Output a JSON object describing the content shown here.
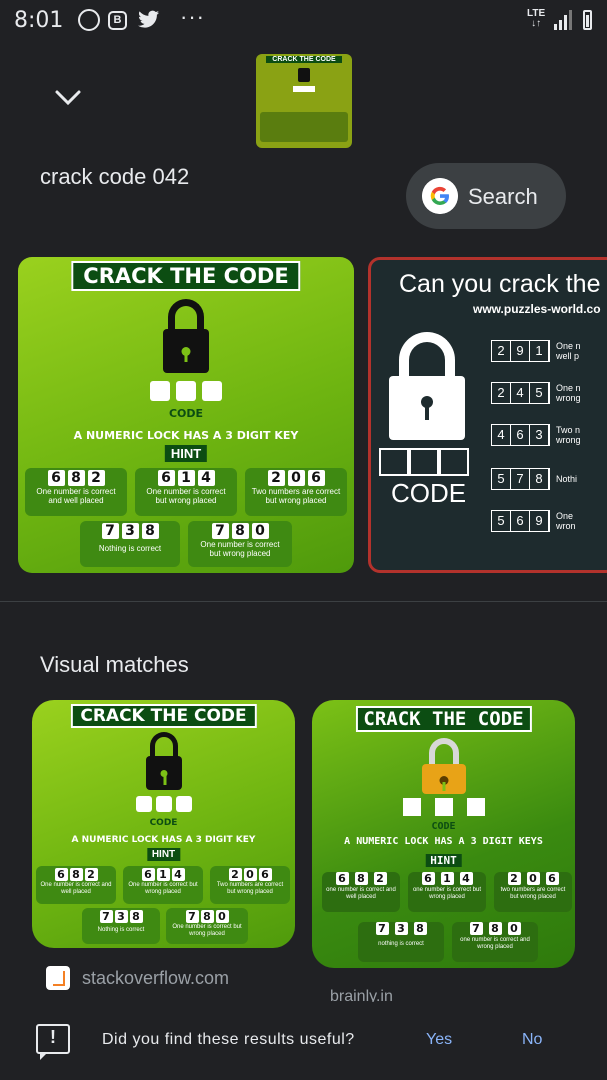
{
  "status_bar": {
    "time": "8:01",
    "network": "LTE",
    "overflow": "···",
    "app_badge": "B"
  },
  "header": {
    "query": "crack code 042",
    "search_label": "Search",
    "thumb_title": "CRACK THE CODE"
  },
  "puzzle": {
    "title": "CRACK THE CODE",
    "code_label": "CODE",
    "statement": "A NUMERIC LOCK HAS A 3 DIGIT KEY",
    "hint": "HINT",
    "clues": [
      {
        "digits": [
          "6",
          "8",
          "2"
        ],
        "text": "One number is correct and well placed"
      },
      {
        "digits": [
          "6",
          "1",
          "4"
        ],
        "text": "One number is correct but wrong placed"
      },
      {
        "digits": [
          "2",
          "0",
          "6"
        ],
        "text": "Two numbers are correct but wrong placed"
      },
      {
        "digits": [
          "7",
          "3",
          "8"
        ],
        "text": "Nothing is correct"
      },
      {
        "digits": [
          "7",
          "8",
          "0"
        ],
        "text": "One number is correct but wrong placed"
      }
    ]
  },
  "card2": {
    "title": "Can you crack the",
    "url": "www.puzzles-world.co",
    "code_label": "CODE",
    "rows": [
      {
        "digits": [
          "2",
          "9",
          "1"
        ],
        "text": [
          "One n",
          "well p"
        ]
      },
      {
        "digits": [
          "2",
          "4",
          "5"
        ],
        "text": [
          "One n",
          "wrong"
        ]
      },
      {
        "digits": [
          "4",
          "6",
          "3"
        ],
        "text": [
          "Two n",
          "wrong"
        ]
      },
      {
        "digits": [
          "5",
          "7",
          "8"
        ],
        "text": [
          "Nothi"
        ]
      },
      {
        "digits": [
          "5",
          "6",
          "9"
        ],
        "text": [
          "One",
          "wron"
        ]
      }
    ]
  },
  "visual_matches": {
    "heading": "Visual matches",
    "card4": {
      "title": "CRACK THE CODE",
      "code_label": "CODE",
      "statement": "A NUMERIC LOCK HAS A 3 DIGIT KEYS",
      "hint": "HINT",
      "clues": [
        {
          "digits": [
            "6",
            "8",
            "2"
          ],
          "text": "one number is correct and well placed"
        },
        {
          "digits": [
            "6",
            "1",
            "4"
          ],
          "text": "one number is correct but wrong placed"
        },
        {
          "digits": [
            "2",
            "0",
            "6"
          ],
          "text": "two numbers are correct but wrong placed"
        },
        {
          "digits": [
            "7",
            "3",
            "8"
          ],
          "text": "nothing is correct"
        },
        {
          "digits": [
            "7",
            "8",
            "0"
          ],
          "text": "one number is correct and wrong placed"
        }
      ]
    },
    "sources": [
      "stackoverflow.com",
      "brainly.in"
    ]
  },
  "feedback": {
    "question": "Did you find these results useful?",
    "yes": "Yes",
    "no": "No"
  },
  "colors": {
    "background": "#202124",
    "link": "#8ab4f8",
    "puzzle_green": "#7cc116",
    "title_green": "#0c4d12",
    "lock_gold": "#e8a317"
  }
}
